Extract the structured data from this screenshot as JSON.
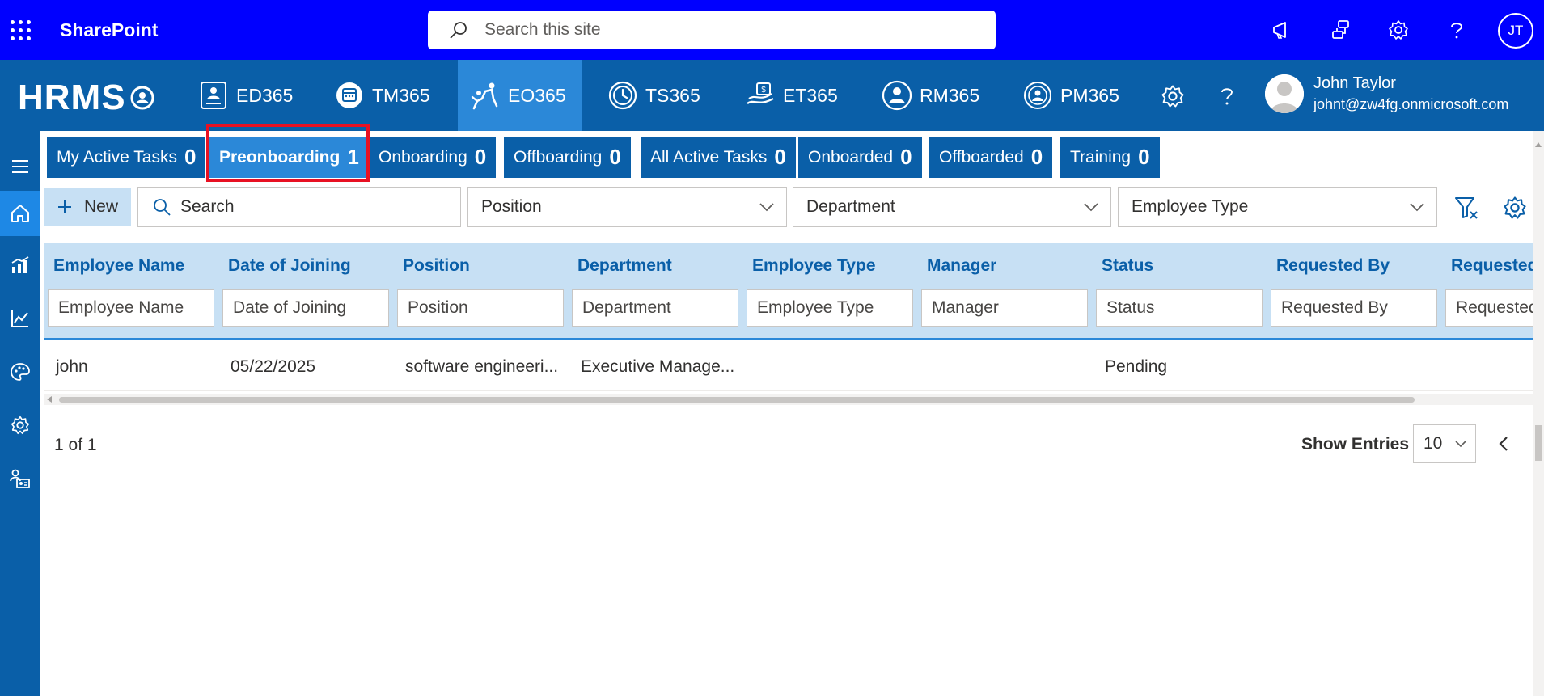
{
  "suite_bar": {
    "brand": "SharePoint",
    "search_placeholder": "Search this site",
    "icons": [
      "app-launcher-icon",
      "megaphone-icon",
      "share-icon",
      "gear-icon",
      "help-icon"
    ],
    "user_initials": "JT",
    "background": "#0000FF"
  },
  "app_bar": {
    "logo": "HRMS",
    "apps": [
      {
        "label": "ED365",
        "icon": "employee-directory-icon",
        "active": false
      },
      {
        "label": "TM365",
        "icon": "task-manager-icon",
        "active": false
      },
      {
        "label": "EO365",
        "icon": "onboarding-icon",
        "active": true
      },
      {
        "label": "TS365",
        "icon": "timesheet-icon",
        "active": false
      },
      {
        "label": "ET365",
        "icon": "expense-tracker-icon",
        "active": false
      },
      {
        "label": "RM365",
        "icon": "recruitment-icon",
        "active": false
      },
      {
        "label": "PM365",
        "icon": "performance-icon",
        "active": false
      }
    ],
    "user": {
      "name": "John Taylor",
      "email": "johnt@zw4fg.onmicrosoft.com"
    },
    "background": "#0A5FA8",
    "active_color": "#2B88D8"
  },
  "rail": {
    "items": [
      "menu-icon",
      "home-icon",
      "analytics-icon",
      "trend-icon",
      "palette-icon",
      "gear-icon",
      "users-icon"
    ],
    "active": "home-icon"
  },
  "status_tabs": [
    {
      "label": "My Active Tasks",
      "count": "0",
      "active": false
    },
    {
      "label": "Preonboarding",
      "count": "1",
      "active": true
    },
    {
      "label": "Onboarding",
      "count": "0",
      "active": false
    },
    {
      "label": "Offboarding",
      "count": "0",
      "active": false
    },
    {
      "label": "All Active Tasks",
      "count": "0",
      "active": false
    },
    {
      "label": "Onboarded",
      "count": "0",
      "active": false
    },
    {
      "label": "Offboarded",
      "count": "0",
      "active": false
    },
    {
      "label": "Training",
      "count": "0",
      "active": false
    }
  ],
  "toolbar": {
    "new_label": "New",
    "search_placeholder": "Search",
    "dropdowns": [
      "Position",
      "Department",
      "Employee Type"
    ]
  },
  "grid": {
    "columns": [
      "Employee Name",
      "Date of Joining",
      "Position",
      "Department",
      "Employee Type",
      "Manager",
      "Status",
      "Requested By",
      "Requested"
    ],
    "filter_placeholders": [
      "Employee Name",
      "Date of Joining",
      "Position",
      "Department",
      "Employee Type",
      "Manager",
      "Status",
      "Requested By",
      "Requested"
    ],
    "rows": [
      [
        "john",
        "05/22/2025",
        "software engineeri...",
        "Executive Manage...",
        "",
        "",
        "Pending",
        "",
        ""
      ]
    ]
  },
  "pager": {
    "page_text": "1 of 1",
    "show_entries_label": "Show Entries",
    "entries_value": "10"
  },
  "highlight_color": "#E81123"
}
